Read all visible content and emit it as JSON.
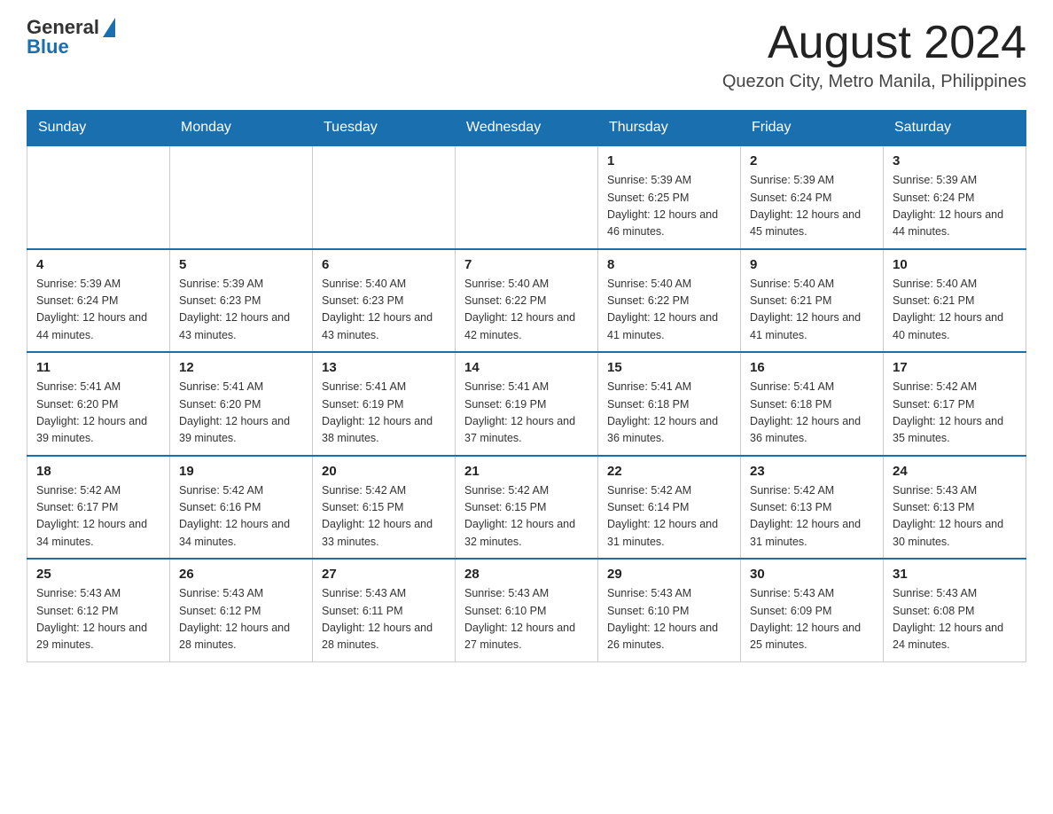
{
  "header": {
    "logo": {
      "text_general": "General",
      "text_blue": "Blue"
    },
    "title": "August 2024",
    "location": "Quezon City, Metro Manila, Philippines"
  },
  "days_of_week": [
    "Sunday",
    "Monday",
    "Tuesday",
    "Wednesday",
    "Thursday",
    "Friday",
    "Saturday"
  ],
  "weeks": [
    {
      "days": [
        {
          "number": "",
          "info": ""
        },
        {
          "number": "",
          "info": ""
        },
        {
          "number": "",
          "info": ""
        },
        {
          "number": "",
          "info": ""
        },
        {
          "number": "1",
          "info": "Sunrise: 5:39 AM\nSunset: 6:25 PM\nDaylight: 12 hours and 46 minutes."
        },
        {
          "number": "2",
          "info": "Sunrise: 5:39 AM\nSunset: 6:24 PM\nDaylight: 12 hours and 45 minutes."
        },
        {
          "number": "3",
          "info": "Sunrise: 5:39 AM\nSunset: 6:24 PM\nDaylight: 12 hours and 44 minutes."
        }
      ]
    },
    {
      "days": [
        {
          "number": "4",
          "info": "Sunrise: 5:39 AM\nSunset: 6:24 PM\nDaylight: 12 hours and 44 minutes."
        },
        {
          "number": "5",
          "info": "Sunrise: 5:39 AM\nSunset: 6:23 PM\nDaylight: 12 hours and 43 minutes."
        },
        {
          "number": "6",
          "info": "Sunrise: 5:40 AM\nSunset: 6:23 PM\nDaylight: 12 hours and 43 minutes."
        },
        {
          "number": "7",
          "info": "Sunrise: 5:40 AM\nSunset: 6:22 PM\nDaylight: 12 hours and 42 minutes."
        },
        {
          "number": "8",
          "info": "Sunrise: 5:40 AM\nSunset: 6:22 PM\nDaylight: 12 hours and 41 minutes."
        },
        {
          "number": "9",
          "info": "Sunrise: 5:40 AM\nSunset: 6:21 PM\nDaylight: 12 hours and 41 minutes."
        },
        {
          "number": "10",
          "info": "Sunrise: 5:40 AM\nSunset: 6:21 PM\nDaylight: 12 hours and 40 minutes."
        }
      ]
    },
    {
      "days": [
        {
          "number": "11",
          "info": "Sunrise: 5:41 AM\nSunset: 6:20 PM\nDaylight: 12 hours and 39 minutes."
        },
        {
          "number": "12",
          "info": "Sunrise: 5:41 AM\nSunset: 6:20 PM\nDaylight: 12 hours and 39 minutes."
        },
        {
          "number": "13",
          "info": "Sunrise: 5:41 AM\nSunset: 6:19 PM\nDaylight: 12 hours and 38 minutes."
        },
        {
          "number": "14",
          "info": "Sunrise: 5:41 AM\nSunset: 6:19 PM\nDaylight: 12 hours and 37 minutes."
        },
        {
          "number": "15",
          "info": "Sunrise: 5:41 AM\nSunset: 6:18 PM\nDaylight: 12 hours and 36 minutes."
        },
        {
          "number": "16",
          "info": "Sunrise: 5:41 AM\nSunset: 6:18 PM\nDaylight: 12 hours and 36 minutes."
        },
        {
          "number": "17",
          "info": "Sunrise: 5:42 AM\nSunset: 6:17 PM\nDaylight: 12 hours and 35 minutes."
        }
      ]
    },
    {
      "days": [
        {
          "number": "18",
          "info": "Sunrise: 5:42 AM\nSunset: 6:17 PM\nDaylight: 12 hours and 34 minutes."
        },
        {
          "number": "19",
          "info": "Sunrise: 5:42 AM\nSunset: 6:16 PM\nDaylight: 12 hours and 34 minutes."
        },
        {
          "number": "20",
          "info": "Sunrise: 5:42 AM\nSunset: 6:15 PM\nDaylight: 12 hours and 33 minutes."
        },
        {
          "number": "21",
          "info": "Sunrise: 5:42 AM\nSunset: 6:15 PM\nDaylight: 12 hours and 32 minutes."
        },
        {
          "number": "22",
          "info": "Sunrise: 5:42 AM\nSunset: 6:14 PM\nDaylight: 12 hours and 31 minutes."
        },
        {
          "number": "23",
          "info": "Sunrise: 5:42 AM\nSunset: 6:13 PM\nDaylight: 12 hours and 31 minutes."
        },
        {
          "number": "24",
          "info": "Sunrise: 5:43 AM\nSunset: 6:13 PM\nDaylight: 12 hours and 30 minutes."
        }
      ]
    },
    {
      "days": [
        {
          "number": "25",
          "info": "Sunrise: 5:43 AM\nSunset: 6:12 PM\nDaylight: 12 hours and 29 minutes."
        },
        {
          "number": "26",
          "info": "Sunrise: 5:43 AM\nSunset: 6:12 PM\nDaylight: 12 hours and 28 minutes."
        },
        {
          "number": "27",
          "info": "Sunrise: 5:43 AM\nSunset: 6:11 PM\nDaylight: 12 hours and 28 minutes."
        },
        {
          "number": "28",
          "info": "Sunrise: 5:43 AM\nSunset: 6:10 PM\nDaylight: 12 hours and 27 minutes."
        },
        {
          "number": "29",
          "info": "Sunrise: 5:43 AM\nSunset: 6:10 PM\nDaylight: 12 hours and 26 minutes."
        },
        {
          "number": "30",
          "info": "Sunrise: 5:43 AM\nSunset: 6:09 PM\nDaylight: 12 hours and 25 minutes."
        },
        {
          "number": "31",
          "info": "Sunrise: 5:43 AM\nSunset: 6:08 PM\nDaylight: 12 hours and 24 minutes."
        }
      ]
    }
  ]
}
